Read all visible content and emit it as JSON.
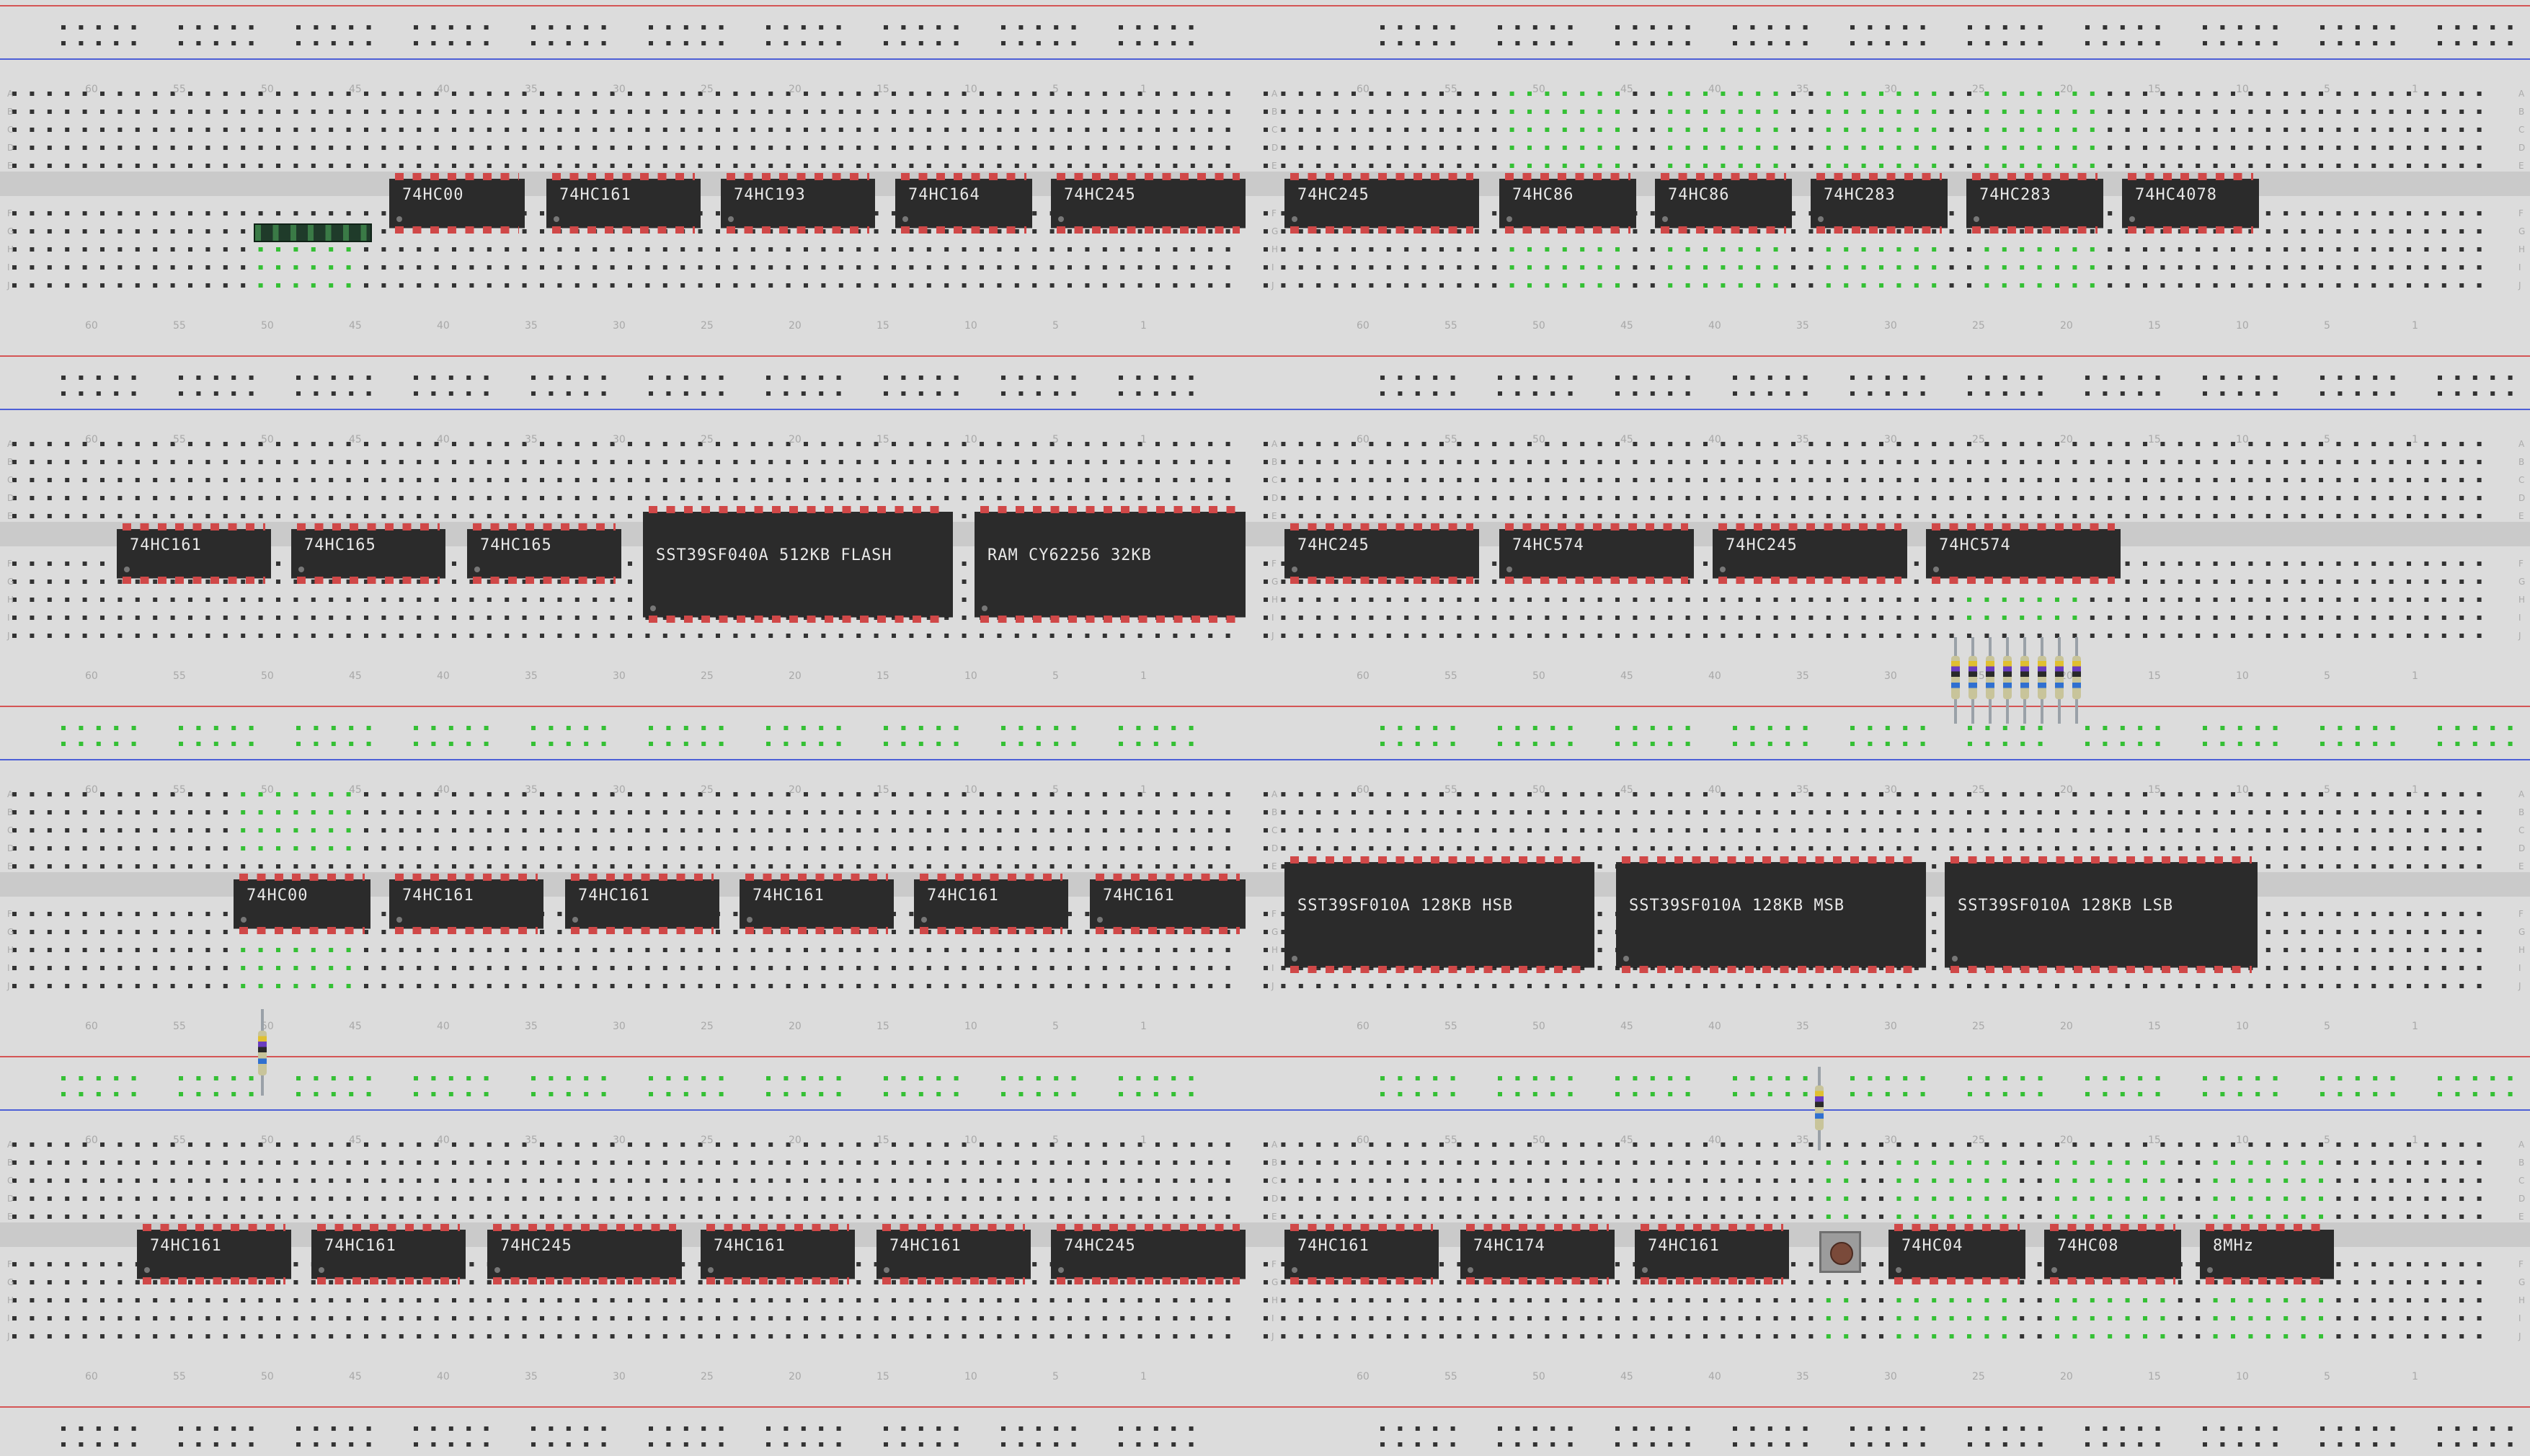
{
  "colors": {
    "board": "#d9d9d9",
    "rail_red": "#d45555",
    "rail_blue": "#4d5fd6",
    "hole": "#333333",
    "connected": "#35c035",
    "chip": "#2b2b2b",
    "pin": "#d04848"
  },
  "chips": [
    {
      "id": "r1c1",
      "label": "74HC00",
      "row": 1
    },
    {
      "id": "r1c2",
      "label": "74HC161",
      "row": 1
    },
    {
      "id": "r1c3",
      "label": "74HC193",
      "row": 1
    },
    {
      "id": "r1c4",
      "label": "74HC164",
      "row": 1
    },
    {
      "id": "r1c5",
      "label": "74HC245",
      "row": 1
    },
    {
      "id": "r1c6",
      "label": "74HC245",
      "row": 1
    },
    {
      "id": "r1c7",
      "label": "74HC86",
      "row": 1
    },
    {
      "id": "r1c8",
      "label": "74HC86",
      "row": 1
    },
    {
      "id": "r1c9",
      "label": "74HC283",
      "row": 1
    },
    {
      "id": "r1c10",
      "label": "74HC283",
      "row": 1
    },
    {
      "id": "r1c11",
      "label": "74HC4078",
      "row": 1
    },
    {
      "id": "r2c1",
      "label": "74HC161",
      "row": 2
    },
    {
      "id": "r2c2",
      "label": "74HC165",
      "row": 2
    },
    {
      "id": "r2c3",
      "label": "74HC165",
      "row": 2
    },
    {
      "id": "r2c4",
      "label": "SST39SF040A 512KB FLASH",
      "row": 2
    },
    {
      "id": "r2c5",
      "label": "RAM CY62256 32KB",
      "row": 2
    },
    {
      "id": "r2c6",
      "label": "74HC245",
      "row": 2
    },
    {
      "id": "r2c7",
      "label": "74HC574",
      "row": 2
    },
    {
      "id": "r2c8",
      "label": "74HC245",
      "row": 2
    },
    {
      "id": "r2c9",
      "label": "74HC574",
      "row": 2
    },
    {
      "id": "r3c1",
      "label": "74HC00",
      "row": 3
    },
    {
      "id": "r3c2",
      "label": "74HC161",
      "row": 3
    },
    {
      "id": "r3c3",
      "label": "74HC161",
      "row": 3
    },
    {
      "id": "r3c4",
      "label": "74HC161",
      "row": 3
    },
    {
      "id": "r3c5",
      "label": "74HC161",
      "row": 3
    },
    {
      "id": "r3c6",
      "label": "74HC161",
      "row": 3
    },
    {
      "id": "r3c7",
      "label": "SST39SF010A 128KB HSB",
      "row": 3
    },
    {
      "id": "r3c8",
      "label": "SST39SF010A 128KB MSB",
      "row": 3
    },
    {
      "id": "r3c9",
      "label": "SST39SF010A 128KB LSB",
      "row": 3
    },
    {
      "id": "r4c1",
      "label": "74HC161",
      "row": 4
    },
    {
      "id": "r4c2",
      "label": "74HC161",
      "row": 4
    },
    {
      "id": "r4c3",
      "label": "74HC245",
      "row": 4
    },
    {
      "id": "r4c4",
      "label": "74HC161",
      "row": 4
    },
    {
      "id": "r4c5",
      "label": "74HC161",
      "row": 4
    },
    {
      "id": "r4c6",
      "label": "74HC245",
      "row": 4
    },
    {
      "id": "r4c7",
      "label": "74HC161",
      "row": 4
    },
    {
      "id": "r4c8",
      "label": "74HC174",
      "row": 4
    },
    {
      "id": "r4c9",
      "label": "74HC161",
      "row": 4
    },
    {
      "id": "r4c10",
      "label": "74HC04",
      "row": 4
    },
    {
      "id": "r4c11",
      "label": "74HC08",
      "row": 4
    },
    {
      "id": "r4c12",
      "label": "8MHz",
      "row": 4
    }
  ],
  "components": {
    "pin_header": "pin-header",
    "resistor_array_count": 8,
    "push_button": "push-button",
    "resistors": [
      "resistor",
      "resistor",
      "resistor"
    ]
  },
  "column_numbers": [
    "60",
    "55",
    "50",
    "45",
    "40",
    "35",
    "30",
    "25",
    "20",
    "15",
    "10",
    "5",
    "1"
  ],
  "row_letters": [
    "A",
    "B",
    "C",
    "D",
    "E",
    "F",
    "G",
    "H",
    "I",
    "J"
  ]
}
